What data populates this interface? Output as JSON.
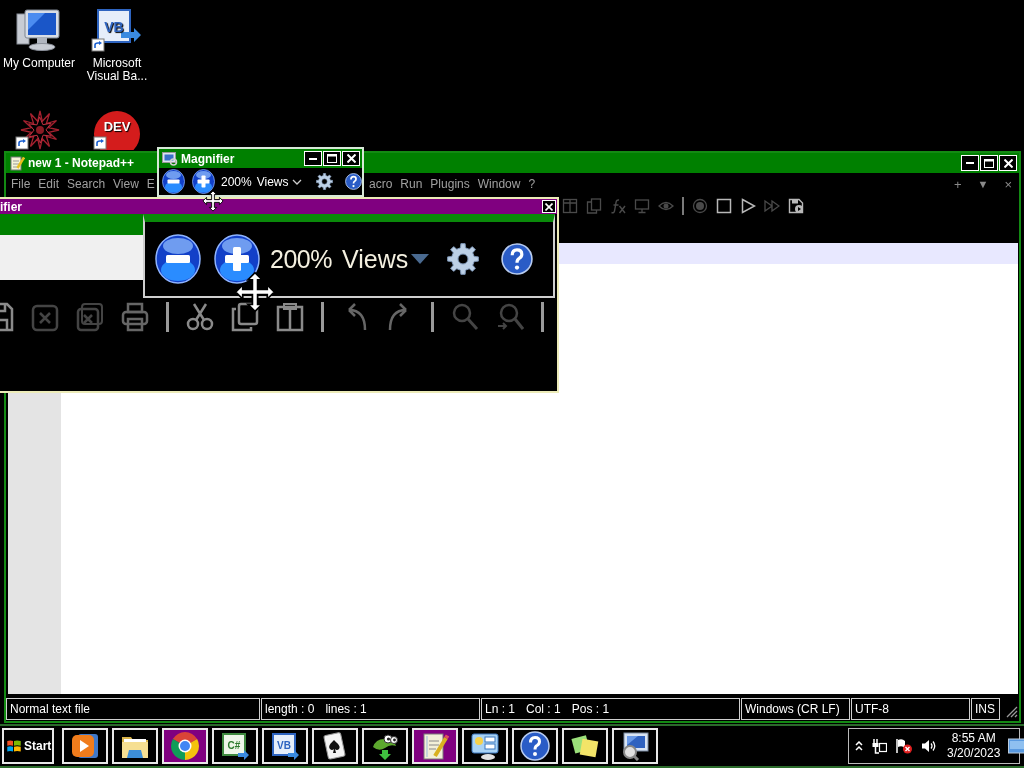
{
  "desktop_icons": [
    {
      "kind": "computer",
      "label": "My Computer"
    },
    {
      "kind": "vb",
      "glyph": "VB",
      "label": "Microsoft Visual Ba..."
    },
    {
      "kind": "star"
    },
    {
      "kind": "dev",
      "glyph": "DEV"
    }
  ],
  "notepad": {
    "title": "new 1 - Notepad++",
    "menu_left": [
      "File",
      "Edit",
      "Search",
      "View",
      "E"
    ],
    "menu_right": [
      "acro",
      "Run",
      "Plugins",
      "Window",
      "?"
    ],
    "tab_controls": [
      {
        "kind": "add",
        "label": "+"
      },
      {
        "kind": "list",
        "label": "▼"
      },
      {
        "kind": "close",
        "label": "×"
      }
    ],
    "toolbar": [
      {
        "kind": "panel",
        "disabled": true
      },
      {
        "kind": "docs",
        "disabled": true
      },
      {
        "kind": "function",
        "disabled": true
      },
      {
        "kind": "monitor",
        "disabled": true
      },
      {
        "kind": "eye",
        "disabled": true
      },
      {
        "kind": "separator"
      },
      {
        "kind": "record",
        "disabled": true
      },
      {
        "kind": "stop",
        "disabled": false
      },
      {
        "kind": "play",
        "disabled": false
      },
      {
        "kind": "fastforward",
        "disabled": true
      },
      {
        "kind": "savemacro",
        "disabled": false
      }
    ],
    "status_bar": [
      [
        "Normal text file"
      ],
      [
        "length : 0",
        "lines : 1"
      ],
      [
        "Ln : 1",
        "Col : 1",
        "Pos : 1"
      ],
      [
        "Windows (CR LF)"
      ],
      [
        "UTF-8"
      ],
      [
        "INS"
      ]
    ]
  },
  "magnifier": {
    "title": "Magnifier",
    "zoom": "200%",
    "views": "Views"
  },
  "lens": {
    "title": "ifier",
    "zoom": "200%",
    "views": "Views",
    "toolbar": [
      {
        "kind": "save"
      },
      {
        "kind": "close"
      },
      {
        "kind": "close_all"
      },
      {
        "kind": "print"
      },
      {
        "kind": "separator"
      },
      {
        "kind": "cut"
      },
      {
        "kind": "copy"
      },
      {
        "kind": "paste"
      },
      {
        "kind": "separator"
      },
      {
        "kind": "undo"
      },
      {
        "kind": "redo"
      },
      {
        "kind": "separator"
      },
      {
        "kind": "find"
      },
      {
        "kind": "replace"
      },
      {
        "kind": "separator"
      }
    ]
  },
  "taskbar": {
    "start": "Start",
    "buttons": [
      {
        "kind": "media",
        "selected": false
      },
      {
        "kind": "folder",
        "selected": false
      },
      {
        "kind": "chrome",
        "selected": true
      },
      {
        "kind": "csharp",
        "glyph": "C#",
        "selected": false
      },
      {
        "kind": "vb",
        "glyph": "VB",
        "selected": false
      },
      {
        "kind": "cards",
        "selected": false
      },
      {
        "kind": "chameleon",
        "selected": false
      },
      {
        "kind": "notepad",
        "selected": true
      },
      {
        "kind": "control",
        "selected": false
      },
      {
        "kind": "help",
        "selected": false
      },
      {
        "kind": "sticky",
        "selected": false
      },
      {
        "kind": "magnifier",
        "selected": false
      }
    ],
    "time": "8:55 AM",
    "date": "3/20/2023"
  }
}
